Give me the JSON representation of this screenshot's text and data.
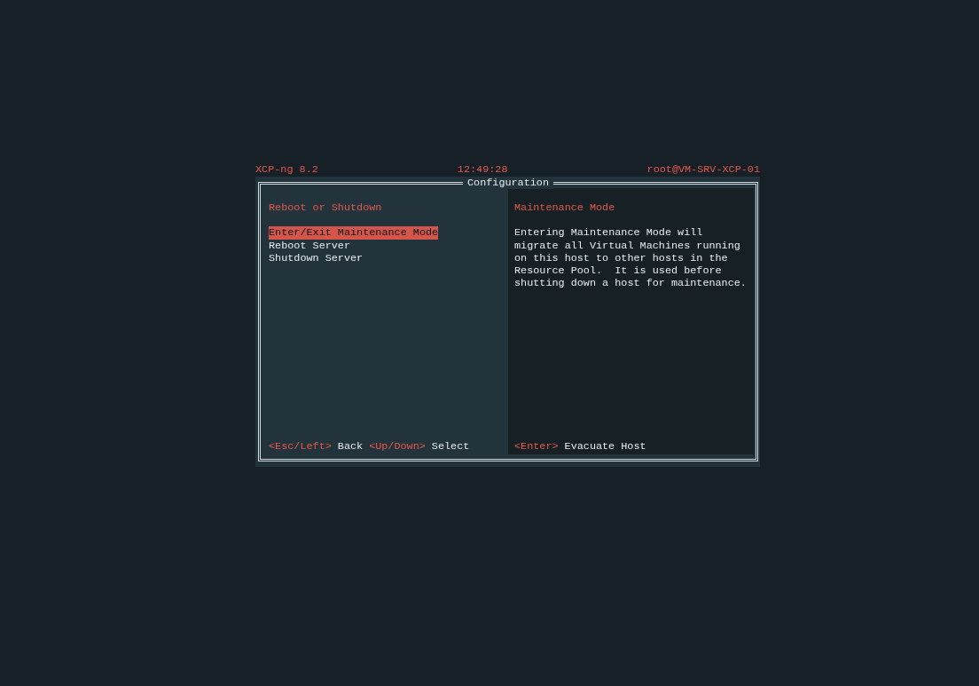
{
  "header": {
    "product": "XCP-ng 8.2",
    "time": "12:49:28",
    "host": "root@VM-SRV-XCP-01"
  },
  "window": {
    "title": "Configuration"
  },
  "left_panel": {
    "title": "Reboot or Shutdown",
    "menu": [
      {
        "label": "Enter/Exit Maintenance Mode",
        "selected": true
      },
      {
        "label": "Reboot Server",
        "selected": false
      },
      {
        "label": "Shutdown Server",
        "selected": false
      }
    ],
    "footer": [
      {
        "key": "<Esc/Left>",
        "action": "Back"
      },
      {
        "key": "<Up/Down>",
        "action": "Select"
      }
    ]
  },
  "right_panel": {
    "title": "Maintenance Mode",
    "description": [
      "Entering Maintenance Mode will",
      "migrate all Virtual Machines running",
      "on this host to other hosts in the",
      "Resource Pool.  It is used before",
      "shutting down a host for maintenance."
    ],
    "footer": [
      {
        "key": "<Enter>",
        "action": "Evacuate Host"
      }
    ]
  }
}
